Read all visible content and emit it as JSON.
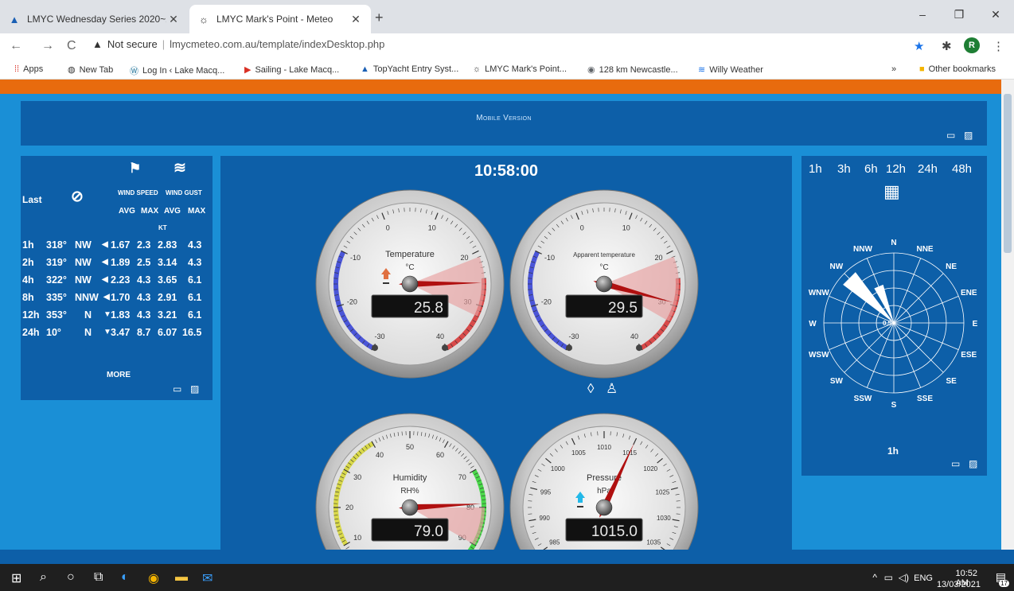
{
  "browser": {
    "tabs": [
      {
        "title": "LMYC Wednesday Series 2020~2",
        "active": false
      },
      {
        "title": "LMYC Mark's Point - Meteo",
        "active": true
      }
    ],
    "new_tab": "+",
    "window_controls": [
      "–",
      "❐",
      "✕"
    ],
    "security_label": "Not secure",
    "url": "lmycmeteo.com.au/template/indexDesktop.php",
    "profile_initial": "R",
    "bookmarks": [
      "Apps",
      "New Tab",
      "Log In ‹ Lake Macq...",
      "Sailing - Lake Macq...",
      "TopYacht Entry Syst...",
      "LMYC Mark's Point...",
      "128 km Newcastle...",
      "Willy Weather"
    ],
    "overflow": "»",
    "other_bookmarks": "Other bookmarks"
  },
  "page": {
    "mobile_version": "Mobile Version",
    "wind": {
      "last_label": "Last",
      "wind_speed": "Wind speed",
      "wind_gust": "Wind gust",
      "avg": "Avg",
      "max": "Max",
      "avg2": "Avg",
      "max2": "Max",
      "unit": "kt",
      "more": "MORE",
      "rows": [
        {
          "period": "1h",
          "dir": "318°",
          "card": "NW",
          "arrow": "◀",
          "speed_avg": "1.67",
          "speed_max": "2.3",
          "gust_avg": "2.83",
          "gust_max": "4.3"
        },
        {
          "period": "2h",
          "dir": "319°",
          "card": "NW",
          "arrow": "◀",
          "speed_avg": "1.89",
          "speed_max": "2.5",
          "gust_avg": "3.14",
          "gust_max": "4.3"
        },
        {
          "period": "4h",
          "dir": "322°",
          "card": "NW",
          "arrow": "◀",
          "speed_avg": "2.23",
          "speed_max": "4.3",
          "gust_avg": "3.65",
          "gust_max": "6.1"
        },
        {
          "period": "8h",
          "dir": "335°",
          "card": "NNW",
          "arrow": "◀",
          "speed_avg": "1.70",
          "speed_max": "4.3",
          "gust_avg": "2.91",
          "gust_max": "6.1"
        },
        {
          "period": "12h",
          "dir": "353°",
          "card": "N",
          "arrow": "▼",
          "speed_avg": "1.83",
          "speed_max": "4.3",
          "gust_avg": "3.21",
          "gust_max": "6.1"
        },
        {
          "period": "24h",
          "dir": "10°",
          "card": "N",
          "arrow": "▼",
          "speed_avg": "3.47",
          "speed_max": "8.7",
          "gust_avg": "6.07",
          "gust_max": "16.5"
        }
      ]
    },
    "clock": "10:58:00",
    "gauges": {
      "temperature": {
        "title": "Temperature",
        "unit": "°C",
        "value": "25.8",
        "ticks": [
          "-30",
          "-20",
          "-10",
          "0",
          "10",
          "20",
          "30",
          "40"
        ],
        "reading": 25.8
      },
      "apparent": {
        "title": "Apparent temperature",
        "unit": "°C",
        "value": "29.5",
        "ticks": [
          "-30",
          "-20",
          "-10",
          "0",
          "10",
          "20",
          "30",
          "40"
        ],
        "reading": 29.5
      },
      "humidity": {
        "title": "Humidity",
        "unit": "RH%",
        "value": "79.0",
        "ticks": [
          "10",
          "20",
          "30",
          "40",
          "50",
          "60",
          "70",
          "80",
          "90"
        ],
        "reading": 79.0
      },
      "pressure": {
        "title": "Pressure",
        "unit": "hPa",
        "value": "1015.0",
        "ticks": [
          "985",
          "990",
          "995",
          "1000",
          "1005",
          "1010",
          "1015",
          "1020",
          "1025",
          "1030",
          "1035"
        ],
        "reading": 1015.0
      }
    },
    "rose": {
      "periods": [
        "1h",
        "3h",
        "6h",
        "12h",
        "24h",
        "48h"
      ],
      "directions": [
        "N",
        "NNE",
        "NE",
        "ENE",
        "E",
        "ESE",
        "SE",
        "SSE",
        "S",
        "SSW",
        "SW",
        "WSW",
        "W",
        "WNW",
        "NW",
        "NNW"
      ],
      "selected_period": "1h",
      "center_value": "0.5"
    }
  },
  "taskbar": {
    "language": "ENG",
    "time": "10:52 AM",
    "date": "13/03/2021",
    "notification_count": "17"
  },
  "colors": {
    "panel": "#0d5fa8",
    "page": "#1a8fd6",
    "accent_orange": "#e86b0e",
    "needle": "#b01010"
  }
}
